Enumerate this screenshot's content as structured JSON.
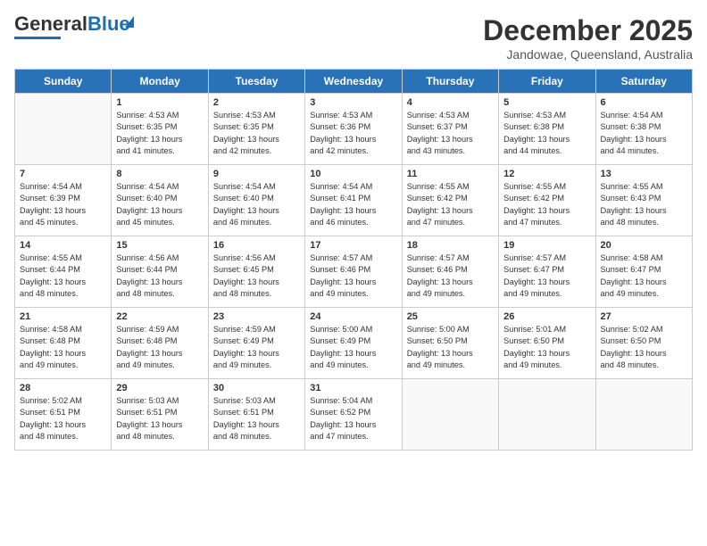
{
  "logo": {
    "general": "General",
    "blue": "Blue"
  },
  "header": {
    "month": "December 2025",
    "location": "Jandowae, Queensland, Australia"
  },
  "days_of_week": [
    "Sunday",
    "Monday",
    "Tuesday",
    "Wednesday",
    "Thursday",
    "Friday",
    "Saturday"
  ],
  "weeks": [
    [
      {
        "day": "",
        "info": ""
      },
      {
        "day": "1",
        "info": "Sunrise: 4:53 AM\nSunset: 6:35 PM\nDaylight: 13 hours\nand 41 minutes."
      },
      {
        "day": "2",
        "info": "Sunrise: 4:53 AM\nSunset: 6:35 PM\nDaylight: 13 hours\nand 42 minutes."
      },
      {
        "day": "3",
        "info": "Sunrise: 4:53 AM\nSunset: 6:36 PM\nDaylight: 13 hours\nand 42 minutes."
      },
      {
        "day": "4",
        "info": "Sunrise: 4:53 AM\nSunset: 6:37 PM\nDaylight: 13 hours\nand 43 minutes."
      },
      {
        "day": "5",
        "info": "Sunrise: 4:53 AM\nSunset: 6:38 PM\nDaylight: 13 hours\nand 44 minutes."
      },
      {
        "day": "6",
        "info": "Sunrise: 4:54 AM\nSunset: 6:38 PM\nDaylight: 13 hours\nand 44 minutes."
      }
    ],
    [
      {
        "day": "7",
        "info": "Sunrise: 4:54 AM\nSunset: 6:39 PM\nDaylight: 13 hours\nand 45 minutes."
      },
      {
        "day": "8",
        "info": "Sunrise: 4:54 AM\nSunset: 6:40 PM\nDaylight: 13 hours\nand 45 minutes."
      },
      {
        "day": "9",
        "info": "Sunrise: 4:54 AM\nSunset: 6:40 PM\nDaylight: 13 hours\nand 46 minutes."
      },
      {
        "day": "10",
        "info": "Sunrise: 4:54 AM\nSunset: 6:41 PM\nDaylight: 13 hours\nand 46 minutes."
      },
      {
        "day": "11",
        "info": "Sunrise: 4:55 AM\nSunset: 6:42 PM\nDaylight: 13 hours\nand 47 minutes."
      },
      {
        "day": "12",
        "info": "Sunrise: 4:55 AM\nSunset: 6:42 PM\nDaylight: 13 hours\nand 47 minutes."
      },
      {
        "day": "13",
        "info": "Sunrise: 4:55 AM\nSunset: 6:43 PM\nDaylight: 13 hours\nand 48 minutes."
      }
    ],
    [
      {
        "day": "14",
        "info": "Sunrise: 4:55 AM\nSunset: 6:44 PM\nDaylight: 13 hours\nand 48 minutes."
      },
      {
        "day": "15",
        "info": "Sunrise: 4:56 AM\nSunset: 6:44 PM\nDaylight: 13 hours\nand 48 minutes."
      },
      {
        "day": "16",
        "info": "Sunrise: 4:56 AM\nSunset: 6:45 PM\nDaylight: 13 hours\nand 48 minutes."
      },
      {
        "day": "17",
        "info": "Sunrise: 4:57 AM\nSunset: 6:46 PM\nDaylight: 13 hours\nand 49 minutes."
      },
      {
        "day": "18",
        "info": "Sunrise: 4:57 AM\nSunset: 6:46 PM\nDaylight: 13 hours\nand 49 minutes."
      },
      {
        "day": "19",
        "info": "Sunrise: 4:57 AM\nSunset: 6:47 PM\nDaylight: 13 hours\nand 49 minutes."
      },
      {
        "day": "20",
        "info": "Sunrise: 4:58 AM\nSunset: 6:47 PM\nDaylight: 13 hours\nand 49 minutes."
      }
    ],
    [
      {
        "day": "21",
        "info": "Sunrise: 4:58 AM\nSunset: 6:48 PM\nDaylight: 13 hours\nand 49 minutes."
      },
      {
        "day": "22",
        "info": "Sunrise: 4:59 AM\nSunset: 6:48 PM\nDaylight: 13 hours\nand 49 minutes."
      },
      {
        "day": "23",
        "info": "Sunrise: 4:59 AM\nSunset: 6:49 PM\nDaylight: 13 hours\nand 49 minutes."
      },
      {
        "day": "24",
        "info": "Sunrise: 5:00 AM\nSunset: 6:49 PM\nDaylight: 13 hours\nand 49 minutes."
      },
      {
        "day": "25",
        "info": "Sunrise: 5:00 AM\nSunset: 6:50 PM\nDaylight: 13 hours\nand 49 minutes."
      },
      {
        "day": "26",
        "info": "Sunrise: 5:01 AM\nSunset: 6:50 PM\nDaylight: 13 hours\nand 49 minutes."
      },
      {
        "day": "27",
        "info": "Sunrise: 5:02 AM\nSunset: 6:50 PM\nDaylight: 13 hours\nand 48 minutes."
      }
    ],
    [
      {
        "day": "28",
        "info": "Sunrise: 5:02 AM\nSunset: 6:51 PM\nDaylight: 13 hours\nand 48 minutes."
      },
      {
        "day": "29",
        "info": "Sunrise: 5:03 AM\nSunset: 6:51 PM\nDaylight: 13 hours\nand 48 minutes."
      },
      {
        "day": "30",
        "info": "Sunrise: 5:03 AM\nSunset: 6:51 PM\nDaylight: 13 hours\nand 48 minutes."
      },
      {
        "day": "31",
        "info": "Sunrise: 5:04 AM\nSunset: 6:52 PM\nDaylight: 13 hours\nand 47 minutes."
      },
      {
        "day": "",
        "info": ""
      },
      {
        "day": "",
        "info": ""
      },
      {
        "day": "",
        "info": ""
      }
    ]
  ]
}
